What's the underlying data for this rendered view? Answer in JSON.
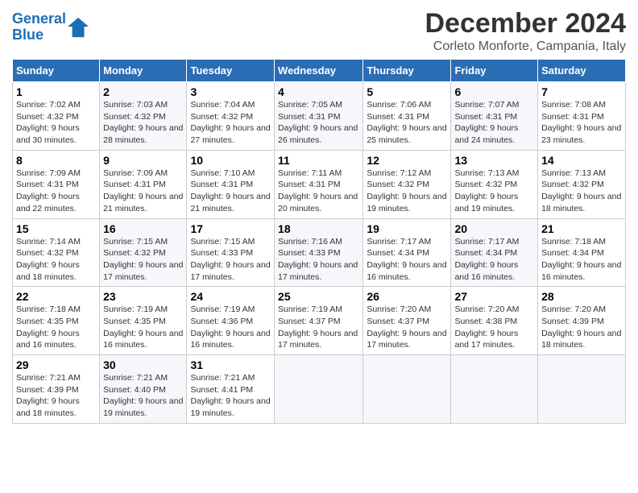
{
  "header": {
    "logo_line1": "General",
    "logo_line2": "Blue",
    "title": "December 2024",
    "subtitle": "Corleto Monforte, Campania, Italy"
  },
  "weekdays": [
    "Sunday",
    "Monday",
    "Tuesday",
    "Wednesday",
    "Thursday",
    "Friday",
    "Saturday"
  ],
  "weeks": [
    [
      {
        "day": "1",
        "sunrise": "7:02 AM",
        "sunset": "4:32 PM",
        "daylight": "9 hours and 30 minutes."
      },
      {
        "day": "2",
        "sunrise": "7:03 AM",
        "sunset": "4:32 PM",
        "daylight": "9 hours and 28 minutes."
      },
      {
        "day": "3",
        "sunrise": "7:04 AM",
        "sunset": "4:32 PM",
        "daylight": "9 hours and 27 minutes."
      },
      {
        "day": "4",
        "sunrise": "7:05 AM",
        "sunset": "4:31 PM",
        "daylight": "9 hours and 26 minutes."
      },
      {
        "day": "5",
        "sunrise": "7:06 AM",
        "sunset": "4:31 PM",
        "daylight": "9 hours and 25 minutes."
      },
      {
        "day": "6",
        "sunrise": "7:07 AM",
        "sunset": "4:31 PM",
        "daylight": "9 hours and 24 minutes."
      },
      {
        "day": "7",
        "sunrise": "7:08 AM",
        "sunset": "4:31 PM",
        "daylight": "9 hours and 23 minutes."
      }
    ],
    [
      {
        "day": "8",
        "sunrise": "7:09 AM",
        "sunset": "4:31 PM",
        "daylight": "9 hours and 22 minutes."
      },
      {
        "day": "9",
        "sunrise": "7:09 AM",
        "sunset": "4:31 PM",
        "daylight": "9 hours and 21 minutes."
      },
      {
        "day": "10",
        "sunrise": "7:10 AM",
        "sunset": "4:31 PM",
        "daylight": "9 hours and 21 minutes."
      },
      {
        "day": "11",
        "sunrise": "7:11 AM",
        "sunset": "4:31 PM",
        "daylight": "9 hours and 20 minutes."
      },
      {
        "day": "12",
        "sunrise": "7:12 AM",
        "sunset": "4:32 PM",
        "daylight": "9 hours and 19 minutes."
      },
      {
        "day": "13",
        "sunrise": "7:13 AM",
        "sunset": "4:32 PM",
        "daylight": "9 hours and 19 minutes."
      },
      {
        "day": "14",
        "sunrise": "7:13 AM",
        "sunset": "4:32 PM",
        "daylight": "9 hours and 18 minutes."
      }
    ],
    [
      {
        "day": "15",
        "sunrise": "7:14 AM",
        "sunset": "4:32 PM",
        "daylight": "9 hours and 18 minutes."
      },
      {
        "day": "16",
        "sunrise": "7:15 AM",
        "sunset": "4:32 PM",
        "daylight": "9 hours and 17 minutes."
      },
      {
        "day": "17",
        "sunrise": "7:15 AM",
        "sunset": "4:33 PM",
        "daylight": "9 hours and 17 minutes."
      },
      {
        "day": "18",
        "sunrise": "7:16 AM",
        "sunset": "4:33 PM",
        "daylight": "9 hours and 17 minutes."
      },
      {
        "day": "19",
        "sunrise": "7:17 AM",
        "sunset": "4:34 PM",
        "daylight": "9 hours and 16 minutes."
      },
      {
        "day": "20",
        "sunrise": "7:17 AM",
        "sunset": "4:34 PM",
        "daylight": "9 hours and 16 minutes."
      },
      {
        "day": "21",
        "sunrise": "7:18 AM",
        "sunset": "4:34 PM",
        "daylight": "9 hours and 16 minutes."
      }
    ],
    [
      {
        "day": "22",
        "sunrise": "7:18 AM",
        "sunset": "4:35 PM",
        "daylight": "9 hours and 16 minutes."
      },
      {
        "day": "23",
        "sunrise": "7:19 AM",
        "sunset": "4:35 PM",
        "daylight": "9 hours and 16 minutes."
      },
      {
        "day": "24",
        "sunrise": "7:19 AM",
        "sunset": "4:36 PM",
        "daylight": "9 hours and 16 minutes."
      },
      {
        "day": "25",
        "sunrise": "7:19 AM",
        "sunset": "4:37 PM",
        "daylight": "9 hours and 17 minutes."
      },
      {
        "day": "26",
        "sunrise": "7:20 AM",
        "sunset": "4:37 PM",
        "daylight": "9 hours and 17 minutes."
      },
      {
        "day": "27",
        "sunrise": "7:20 AM",
        "sunset": "4:38 PM",
        "daylight": "9 hours and 17 minutes."
      },
      {
        "day": "28",
        "sunrise": "7:20 AM",
        "sunset": "4:39 PM",
        "daylight": "9 hours and 18 minutes."
      }
    ],
    [
      {
        "day": "29",
        "sunrise": "7:21 AM",
        "sunset": "4:39 PM",
        "daylight": "9 hours and 18 minutes."
      },
      {
        "day": "30",
        "sunrise": "7:21 AM",
        "sunset": "4:40 PM",
        "daylight": "9 hours and 19 minutes."
      },
      {
        "day": "31",
        "sunrise": "7:21 AM",
        "sunset": "4:41 PM",
        "daylight": "9 hours and 19 minutes."
      },
      null,
      null,
      null,
      null
    ]
  ]
}
